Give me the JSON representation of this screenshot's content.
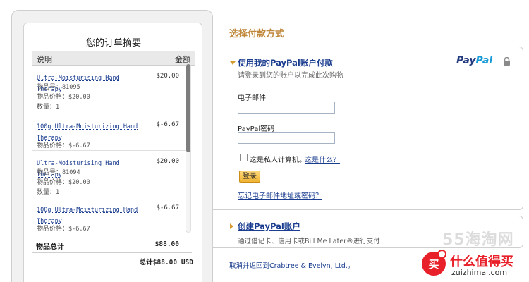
{
  "order": {
    "title": "您的订单摘要",
    "col_desc": "说明",
    "col_amount": "金额",
    "items": [
      {
        "name": "Ultra-Moisturising Hand Therapy",
        "amount": "$20.00",
        "item_no_label": "物品号：",
        "item_no": "81095",
        "price_label": "物品价格：",
        "price": "$20.00",
        "qty_label": "数量：",
        "qty": "1"
      },
      {
        "name": "100g Ultra-Moisturizing Hand Therapy",
        "amount": "$-6.67",
        "price_label": "物品价格：",
        "price": "$-6.67"
      },
      {
        "name": "Ultra-Moisturising Hand Therapy",
        "amount": "$20.00",
        "item_no_label": "物品号：",
        "item_no": "81094",
        "price_label": "物品价格：",
        "price": "$20.00",
        "qty_label": "数量：",
        "qty": "1"
      },
      {
        "name": "100g Ultra-Moisturizing Hand Therapy",
        "amount": "$-6.67",
        "price_label": "物品价格：",
        "price": "$-6.67"
      }
    ],
    "subtotal_label": "物品总计",
    "subtotal": "$88.00",
    "grand_total": "总计$88.00 USD"
  },
  "payment": {
    "section_title": "选择付款方式",
    "paypal_heading": "使用我的PayPal账户付款",
    "paypal_sub": "请登录到您的账户以完成此次购物",
    "logo_part1": "Pay",
    "logo_part2": "Pal",
    "email_label": "电子邮件",
    "email_value": "",
    "password_label": "PayPal密码",
    "password_value": "",
    "private_label": "这是私人计算机。",
    "whats_this": "这是什么？",
    "login_button": "登录",
    "forgot_link": "忘记电子邮件地址或密码？",
    "create_heading": "创建PayPal账户",
    "create_sub": "通过借记卡、信用卡或Bill Me Later®进行支付",
    "cancel_link": "取消并返回到Crabtree & Evelyn, Ltd.。"
  },
  "watermark": {
    "top": "55海淘网",
    "badge": "买",
    "name": "什么值得买",
    "site": "zuizhimai.com"
  },
  "colors": {
    "accent_title": "#c0883b",
    "link": "#1a3d8f",
    "button": "#f0b334"
  }
}
